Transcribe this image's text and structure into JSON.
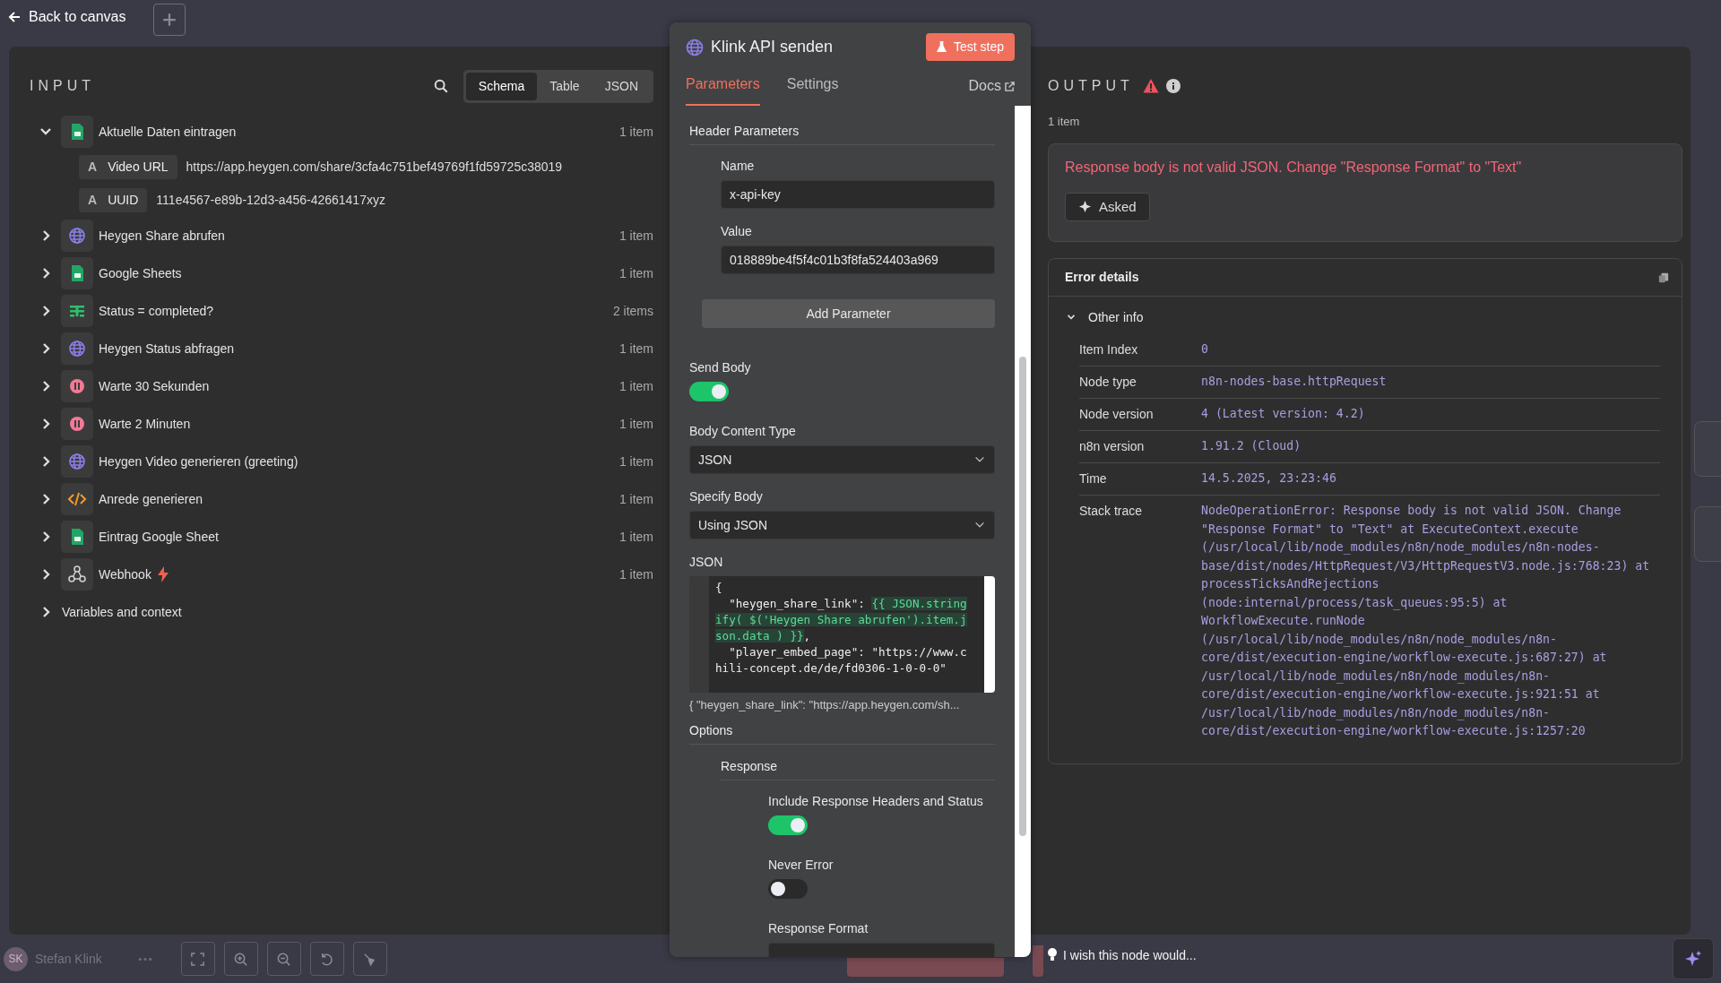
{
  "top_bar": {
    "back_label": "Back to canvas"
  },
  "input": {
    "title": "INPUT",
    "view_tabs": [
      {
        "label": "Schema",
        "selected": true
      },
      {
        "label": "Table",
        "selected": false
      },
      {
        "label": "JSON",
        "selected": false
      }
    ],
    "nodes": [
      {
        "name": "Aktuelle Daten eintragen",
        "kind": "sheets",
        "count": "1 item",
        "expanded": true,
        "trigger": false,
        "fields": [
          {
            "type": "A",
            "key": "Video URL",
            "value": "https://app.heygen.com/share/3cfa4c751bef49769f1fd59725c38019"
          },
          {
            "type": "A",
            "key": "UUID",
            "value": "111e4567-e89b-12d3-a456-42661417xyz"
          }
        ]
      },
      {
        "name": "Heygen Share abrufen",
        "kind": "http",
        "count": "1 item",
        "expanded": false,
        "trigger": false
      },
      {
        "name": "Google Sheets",
        "kind": "sheets",
        "count": "1 item",
        "expanded": false,
        "trigger": false
      },
      {
        "name": "Status = completed?",
        "kind": "if",
        "count": "2 items",
        "expanded": false,
        "trigger": false
      },
      {
        "name": "Heygen Status abfragen",
        "kind": "http",
        "count": "1 item",
        "expanded": false,
        "trigger": false
      },
      {
        "name": "Warte 30 Sekunden",
        "kind": "wait",
        "count": "1 item",
        "expanded": false,
        "trigger": false
      },
      {
        "name": "Warte 2 Minuten",
        "kind": "wait",
        "count": "1 item",
        "expanded": false,
        "trigger": false
      },
      {
        "name": "Heygen Video generieren (greeting)",
        "kind": "http",
        "count": "1 item",
        "expanded": false,
        "trigger": false
      },
      {
        "name": "Anrede generieren",
        "kind": "code",
        "count": "1 item",
        "expanded": false,
        "trigger": false
      },
      {
        "name": "Eintrag Google Sheet",
        "kind": "sheets",
        "count": "1 item",
        "expanded": false,
        "trigger": false
      },
      {
        "name": "Webhook",
        "kind": "webhook",
        "count": "1 item",
        "expanded": false,
        "trigger": true
      }
    ],
    "variables": {
      "label": "Variables and context",
      "expanded": false
    }
  },
  "node_panel": {
    "title": "Klink API senden",
    "test_button": "Test step",
    "tabs": [
      {
        "label": "Parameters",
        "selected": true
      },
      {
        "label": "Settings",
        "selected": false
      }
    ],
    "docs_link": "Docs",
    "fields": [
      {
        "kind": "section",
        "label": "Header Parameters",
        "children": [
          {
            "kind": "input",
            "label": "Name",
            "value": "x-api-key"
          },
          {
            "kind": "input",
            "label": "Value",
            "value": "018889be4f5f4c01b3f8fa524403a969"
          }
        ]
      },
      {
        "kind": "button",
        "label": "Add Parameter"
      },
      {
        "kind": "toggle",
        "label": "Send Body",
        "on": true
      },
      {
        "kind": "select",
        "label": "Body Content Type",
        "value": "JSON"
      },
      {
        "kind": "select",
        "label": "Specify Body",
        "value": "Using JSON"
      },
      {
        "kind": "code",
        "label": "JSON",
        "lines": [
          [
            {
              "text": "{",
              "expression": false
            }
          ],
          [
            {
              "text": "  \"heygen_share_link\": ",
              "expression": false
            },
            {
              "text": "{{ JSON.stringify( $('Heygen Share abrufen').item.json.data ) }}",
              "expression": true
            },
            {
              "text": ",",
              "expression": false
            }
          ],
          [
            {
              "text": "  \"player_embed_page\": \"https://www.chili-concept.de/de/fd0306-1-0-0-0\"",
              "expression": false
            }
          ]
        ],
        "preview": "{  \"heygen_share_link\": \"https://app.heygen.com/sh..."
      },
      {
        "kind": "section",
        "label": "Options",
        "children": [
          {
            "kind": "section",
            "label": "Response",
            "children": [
              {
                "kind": "toggle",
                "label": "Include Response Headers and Status",
                "on": true
              },
              {
                "kind": "toggle",
                "label": "Never Error",
                "on": false
              },
              {
                "kind": "select",
                "label": "Response Format"
              }
            ]
          }
        ]
      }
    ]
  },
  "output": {
    "title": "OUTPUT",
    "count": "1 item",
    "error_message": "Response body is not valid JSON. Change \"Response Format\" to \"Text\"",
    "asked_button": "Asked",
    "details": {
      "title": "Error details",
      "group": {
        "label": "Other info",
        "expanded": true
      },
      "rows": [
        {
          "key": "Item Index",
          "value": "0"
        },
        {
          "key": "Node type",
          "value": "n8n-nodes-base.httpRequest"
        },
        {
          "key": "Node version",
          "value": "4 (Latest version: 4.2)"
        },
        {
          "key": "n8n version",
          "value": "1.91.2 (Cloud)"
        },
        {
          "key": "Time",
          "value": "14.5.2025, 23:23:46"
        },
        {
          "key": "Stack trace",
          "value": "NodeOperationError: Response body is not valid JSON. Change \"Response Format\" to \"Text\" at ExecuteContext.execute (/usr/local/lib/node_modules/n8n/node_modules/n8n-nodes-base/dist/nodes/HttpRequest/V3/HttpRequestV3.node.js:768:23) at processTicksAndRejections (node:internal/process/task_queues:95:5) at WorkflowExecute.runNode (/usr/local/lib/node_modules/n8n/node_modules/n8n-core/dist/execution-engine/workflow-execute.js:687:27) at /usr/local/lib/node_modules/n8n/node_modules/n8n-core/dist/execution-engine/workflow-execute.js:921:51 at /usr/local/lib/node_modules/n8n/node_modules/n8n-core/dist/execution-engine/workflow-execute.js:1257:20"
        }
      ]
    }
  },
  "bottom_bar": {
    "user_initials": "SK",
    "user_name": "Stefan Klink",
    "ask_field": {
      "placeholder": "I wish this node would..."
    }
  }
}
